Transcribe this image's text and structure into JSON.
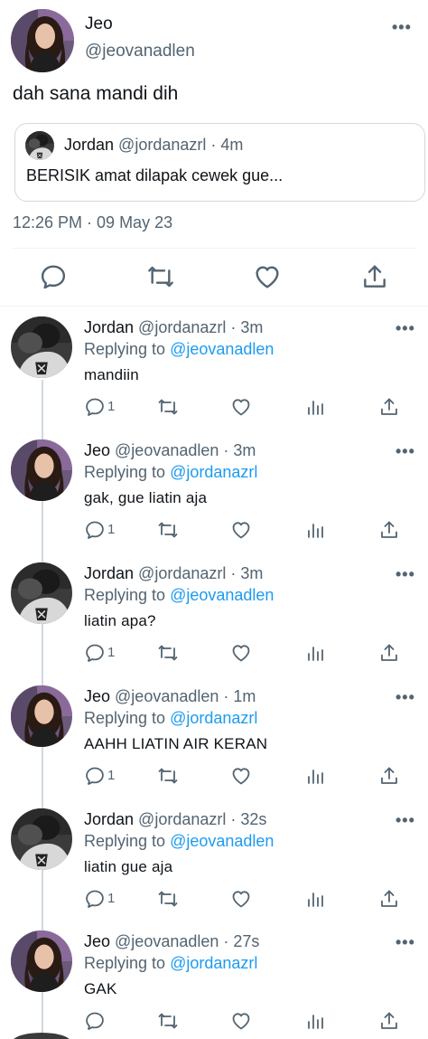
{
  "main": {
    "name": "Jeo",
    "handle": "@jeovanadlen",
    "text": "dah sana mandi dih",
    "quote": {
      "name": "Jordan",
      "meta": " @jordanazrl · 4m",
      "text": "BERISIK amat dilapak cewek gue..."
    },
    "timestamp": "12:26 PM · 09 May 23",
    "actions": [
      "reply-icon",
      "retweet-icon",
      "like-icon",
      "share-icon"
    ]
  },
  "replies": [
    {
      "name": "Jordan",
      "meta": " @jordanazrl · 3m",
      "replying_prefix": "Replying to ",
      "replying_to": "@jeovanadlen",
      "text": "mandiin",
      "reply_count": "1",
      "avatar": "jordan"
    },
    {
      "name": "Jeo",
      "meta": " @jeovanadlen · 3m",
      "replying_prefix": "Replying to ",
      "replying_to": "@jordanazrl",
      "text": "gak, gue liatin aja",
      "reply_count": "1",
      "avatar": "jeo"
    },
    {
      "name": "Jordan",
      "meta": " @jordanazrl · 3m",
      "replying_prefix": "Replying to ",
      "replying_to": "@jeovanadlen",
      "text": "liatin apa?",
      "reply_count": "1",
      "avatar": "jordan"
    },
    {
      "name": "Jeo",
      "meta": " @jeovanadlen · 1m",
      "replying_prefix": "Replying to ",
      "replying_to": "@jordanazrl",
      "text": "AAHH LIATIN AIR KERAN",
      "reply_count": "1",
      "avatar": "jeo"
    },
    {
      "name": "Jordan",
      "meta": " @jordanazrl · 32s",
      "replying_prefix": "Replying to ",
      "replying_to": "@jeovanadlen",
      "text": "liatin gue aja",
      "reply_count": "1",
      "avatar": "jordan"
    },
    {
      "name": "Jeo",
      "meta": " @jeovanadlen · 27s",
      "replying_prefix": "Replying to ",
      "replying_to": "@jordanazrl",
      "text": "GAK",
      "reply_count": "",
      "avatar": "jeo"
    }
  ],
  "colors": {
    "link": "#1d9bf0",
    "secondary_text": "#536471",
    "primary_text": "#0f1419",
    "border": "#cfd9de"
  }
}
